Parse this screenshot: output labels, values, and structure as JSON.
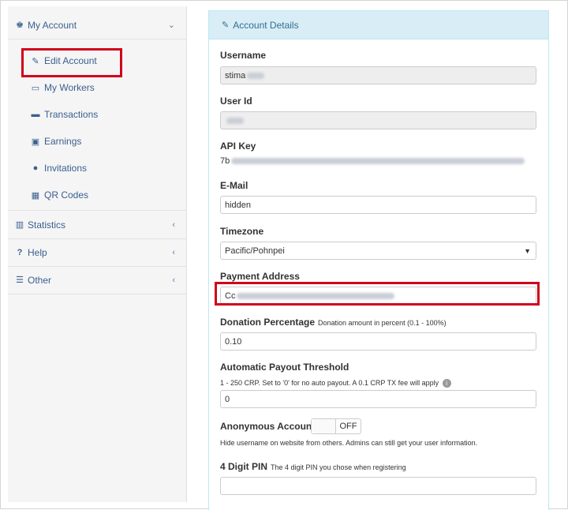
{
  "sidebar": {
    "my_account": {
      "label": "My Account",
      "icon": "user-tie-icon"
    },
    "items": [
      {
        "label": "Edit Account",
        "icon": "edit-icon"
      },
      {
        "label": "My Workers",
        "icon": "monitor-icon"
      },
      {
        "label": "Transactions",
        "icon": "credit-card-icon"
      },
      {
        "label": "Earnings",
        "icon": "money-icon"
      },
      {
        "label": "Invitations",
        "icon": "users-icon"
      },
      {
        "label": "QR Codes",
        "icon": "qrcode-icon"
      }
    ],
    "statistics": {
      "label": "Statistics",
      "icon": "bar-chart-icon"
    },
    "help": {
      "label": "Help",
      "icon": "question-icon"
    },
    "other": {
      "label": "Other",
      "icon": "list-icon"
    }
  },
  "panel": {
    "title": "Account Details",
    "icon": "edit-icon"
  },
  "form": {
    "username_label": "Username",
    "username_value": "stima",
    "userid_label": "User Id",
    "apikey_label": "API Key",
    "apikey_value": "7b",
    "email_label": "E-Mail",
    "email_value": "hidden",
    "timezone_label": "Timezone",
    "timezone_value": "Pacific/Pohnpei",
    "payment_label": "Payment Address",
    "payment_value": "Cc",
    "donation_label": "Donation Percentage",
    "donation_hint": "Donation amount in percent (0.1 - 100%)",
    "donation_value": "0.10",
    "payout_label": "Automatic Payout Threshold",
    "payout_hint": "1 - 250 CRP. Set to '0' for no auto payout. A 0.1 CRP TX fee will apply",
    "payout_value": "0",
    "anon_label": "Anonymous Account",
    "anon_state": "OFF",
    "anon_hint": "Hide username on website from others. Admins can still get your user information.",
    "pin_label": "4 Digit PIN",
    "pin_hint": "The 4 digit PIN you chose when registering",
    "pin_value": ""
  },
  "colors": {
    "highlight": "#d0021b",
    "link": "#3a5f8f",
    "panel_head": "#d9edf7"
  }
}
